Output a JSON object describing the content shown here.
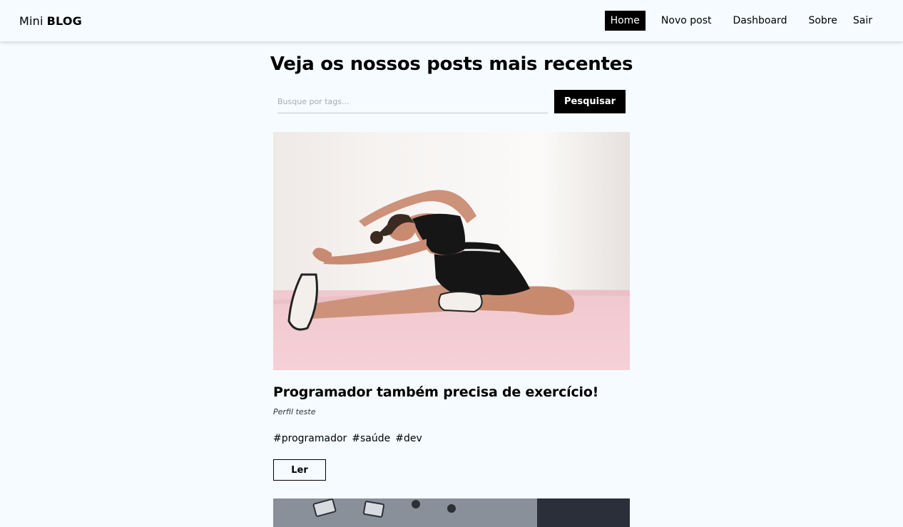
{
  "navbar": {
    "brand_light": "Mini",
    "brand_bold": "BLOG",
    "links": [
      {
        "label": "Home",
        "active": true
      },
      {
        "label": "Novo post",
        "active": false
      },
      {
        "label": "Dashboard",
        "active": false
      },
      {
        "label": "Sobre",
        "active": false
      }
    ],
    "logout_label": "Sair"
  },
  "main": {
    "title": "Veja os nossos posts mais recentes",
    "search": {
      "placeholder": "Busque por tags...",
      "value": "",
      "button_label": "Pesquisar"
    }
  },
  "posts": [
    {
      "title": "Programador também precisa de exercício!",
      "author": "Perfil teste",
      "tags": [
        "#programador",
        "#saúde",
        "#dev"
      ],
      "read_label": "Ler"
    }
  ],
  "colors": {
    "background": "#f5fbff",
    "accent": "#000000",
    "active_nav_text": "#ffffff"
  }
}
